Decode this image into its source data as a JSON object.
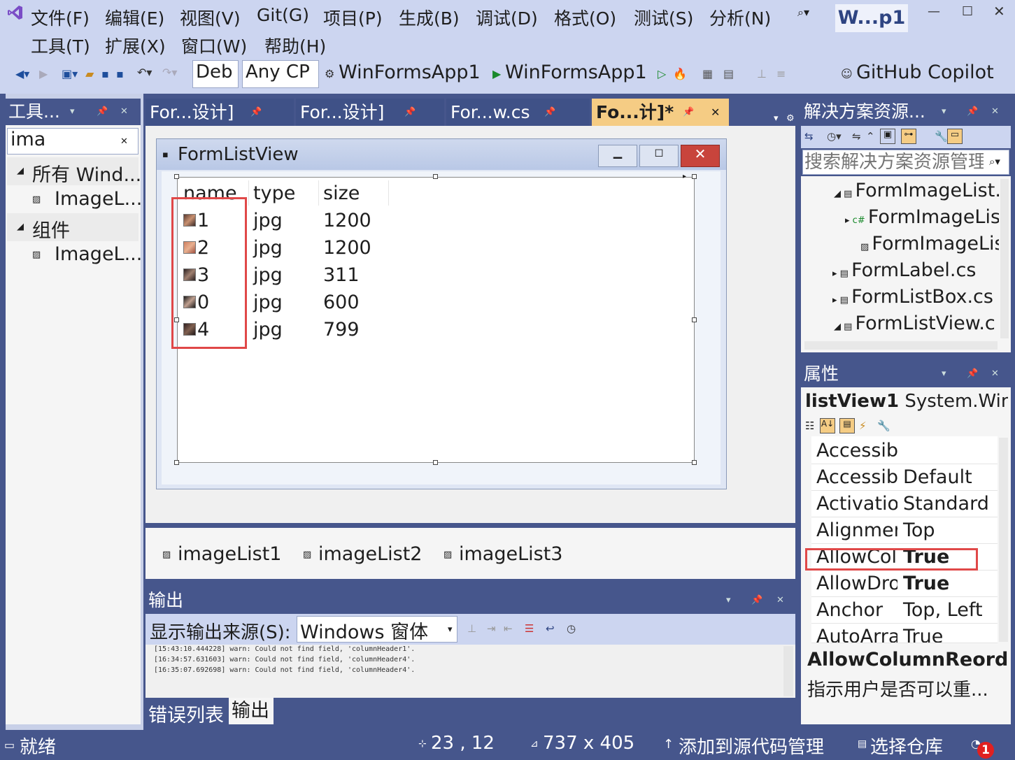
{
  "menu": {
    "file": "文件(F)",
    "edit": "编辑(E)",
    "view": "视图(V)",
    "git": "Git(G)",
    "project": "项目(P)",
    "build": "生成(B)",
    "debug": "调试(D)",
    "format": "格式(O)",
    "test": "测试(S)",
    "analyze": "分析(N)",
    "tools": "工具(T)",
    "extensions": "扩展(X)",
    "window": "窗口(W)",
    "help": "帮助(H)"
  },
  "title_badge": "W...p1",
  "toolbar": {
    "config": "Deb",
    "platform": "Any CP",
    "startup_project": "WinFormsApp1",
    "run_target": "WinFormsApp1",
    "copilot": "GitHub Copilot"
  },
  "toolbox": {
    "title": "工具...",
    "search_value": "ima",
    "groups": [
      {
        "label": "所有 Wind...",
        "items": [
          "ImageL..."
        ]
      },
      {
        "label": "组件",
        "items": [
          "ImageL..."
        ]
      }
    ]
  },
  "doc_tabs": [
    "For...设计]",
    "For...设计]",
    "For...w.cs",
    "Fo...计]*"
  ],
  "designer": {
    "form_title": "FormListView",
    "columns": [
      "name",
      "type",
      "size"
    ],
    "rows": [
      {
        "name": "1",
        "type": "jpg",
        "size": "1200"
      },
      {
        "name": "2",
        "type": "jpg",
        "size": "1200"
      },
      {
        "name": "3",
        "type": "jpg",
        "size": "311"
      },
      {
        "name": "0",
        "type": "jpg",
        "size": "600"
      },
      {
        "name": "4",
        "type": "jpg",
        "size": "799"
      }
    ],
    "components": [
      "imageList1",
      "imageList2",
      "imageList3"
    ]
  },
  "output": {
    "title": "输出",
    "source_label": "显示输出来源(S):",
    "source_value": "Windows 窗体",
    "lines": [
      "[15:43:10.444228] warn: Could not find field, 'columnHeader1'.",
      "[16:34:57.631603] warn: Could not find field, 'columnHeader4'.",
      "[16:35:07.692698] warn: Could not find field, 'columnHeader4'."
    ],
    "tabs": [
      "错误列表",
      "输出"
    ]
  },
  "solution": {
    "title": "解决方案资源...",
    "search_placeholder": "搜索解决方案资源管理",
    "items": [
      "FormImageList.",
      "FormImageLis",
      "FormImageLis",
      "FormLabel.cs",
      "FormListBox.cs",
      "FormListView.c"
    ]
  },
  "properties": {
    "title": "属性",
    "object_name": "listView1",
    "object_type": "System.Win",
    "rows": [
      {
        "name": "Accessibl",
        "value": ""
      },
      {
        "name": "Accessibl",
        "value": "Default"
      },
      {
        "name": "Activatior",
        "value": "Standard"
      },
      {
        "name": "Alignmer",
        "value": "Top"
      },
      {
        "name": "AllowColu",
        "value": "True"
      },
      {
        "name": "AllowDro",
        "value": "True"
      },
      {
        "name": "Anchor",
        "value": "Top, Left"
      },
      {
        "name": "AutoArra",
        "value": "True"
      }
    ],
    "desc_title": "AllowColumnReord",
    "desc_text": "指示用户是否可以重..."
  },
  "status": {
    "ready": "就绪",
    "position": "23 , 12",
    "size": "737 x 405",
    "source_control": "添加到源代码管理",
    "repo": "选择仓库",
    "notifications": "1"
  },
  "colors": {
    "accent": "#46568c",
    "highlight_red": "#e04848",
    "tab_active": "#f5cc84"
  }
}
